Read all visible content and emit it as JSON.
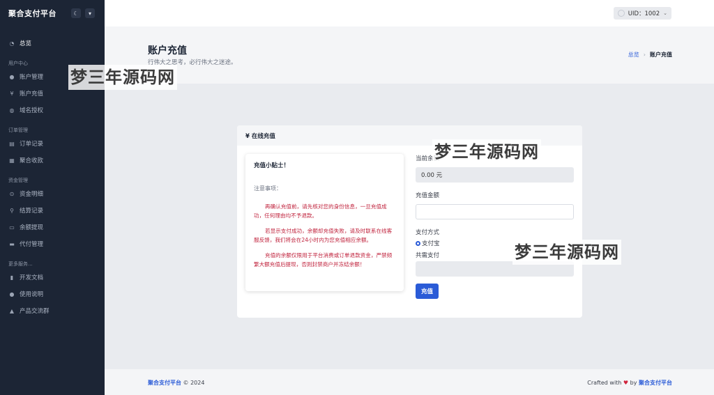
{
  "sidebar": {
    "brand": "聚合支付平台",
    "moon_icon": "moon-icon",
    "sections": [
      {
        "title": "",
        "items": [
          {
            "label": "总览",
            "icon": "dashboard-icon",
            "active": true
          }
        ]
      },
      {
        "title": "用户中心",
        "items": [
          {
            "label": "账户管理",
            "icon": "user-icon"
          },
          {
            "label": "账户充值",
            "icon": "yen-icon"
          },
          {
            "label": "域名授权",
            "icon": "globe-icon"
          }
        ]
      },
      {
        "title": "订单管理",
        "items": [
          {
            "label": "订单记录",
            "icon": "cart-icon"
          },
          {
            "label": "聚合收款",
            "icon": "qrcode-icon"
          }
        ]
      },
      {
        "title": "资金管理",
        "items": [
          {
            "label": "资金明细",
            "icon": "search-icon"
          },
          {
            "label": "结算记录",
            "icon": "search-icon"
          },
          {
            "label": "余额提现",
            "icon": "cash-icon"
          },
          {
            "label": "代付管理",
            "icon": "card-icon"
          }
        ]
      },
      {
        "title": "更多服务...",
        "items": [
          {
            "label": "开发文档",
            "icon": "book-icon"
          },
          {
            "label": "使用说明",
            "icon": "help-icon"
          },
          {
            "label": "产品交流群",
            "icon": "bell-icon"
          }
        ]
      }
    ]
  },
  "topbar": {
    "uid_label": "UID：1002"
  },
  "page": {
    "title": "账户充值",
    "subtitle": "行伟大之思考，必行伟大之迷途。",
    "breadcrumb_home": "总览",
    "breadcrumb_current": "账户充值"
  },
  "card": {
    "title": "¥ 在线充值",
    "tips": {
      "title": "充值小贴士！",
      "label": "注意事项：",
      "paragraphs": [
        "再确认充值前，请先核对您的身份信息，一旦充值成功，任何理由均不予退款。",
        "若显示支付成功，余额却充值失败，请及时联系在线客服反馈，我们将会在24小时内为您充值相应余额。",
        "充值的余额仅限用于平台消费或订单退款资金，严禁频繁大额充值后提现，否则封禁商户并冻结余额！"
      ]
    },
    "form": {
      "balance_label": "当前余额",
      "balance_value": "0.00 元",
      "amount_label": "充值金额",
      "amount_value": "",
      "method_label": "支付方式",
      "method_option": "支付宝",
      "need_label": "共需支付",
      "need_value": "",
      "submit_label": "充值"
    }
  },
  "footer": {
    "left_brand": "聚合支付平台",
    "left_copy": " © 2024",
    "right_prefix": "Crafted with ",
    "right_by": " by ",
    "right_brand": "聚合支付平台"
  },
  "watermark": "梦三年源码网",
  "colors": {
    "sidebar": "#1c2535",
    "accent": "#2a5bd7",
    "warning_text": "#c0233d"
  }
}
